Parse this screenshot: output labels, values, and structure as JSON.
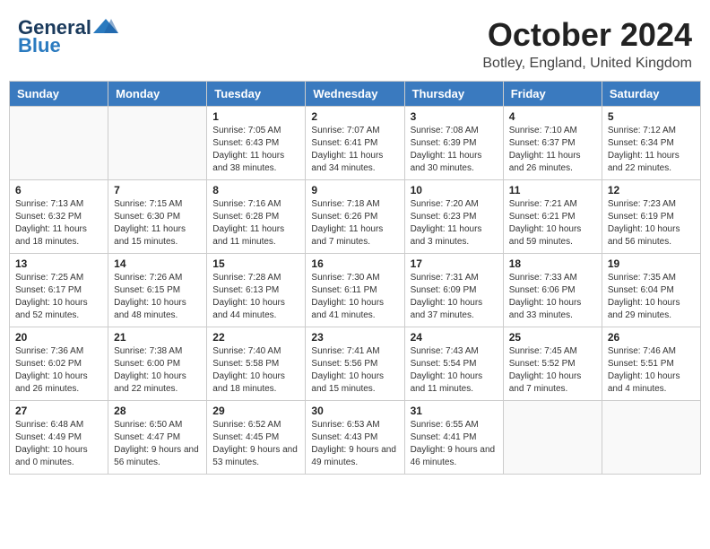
{
  "header": {
    "logo_general": "General",
    "logo_blue": "Blue",
    "month": "October 2024",
    "location": "Botley, England, United Kingdom"
  },
  "days_of_week": [
    "Sunday",
    "Monday",
    "Tuesday",
    "Wednesday",
    "Thursday",
    "Friday",
    "Saturday"
  ],
  "weeks": [
    [
      {
        "day": "",
        "detail": ""
      },
      {
        "day": "",
        "detail": ""
      },
      {
        "day": "1",
        "detail": "Sunrise: 7:05 AM\nSunset: 6:43 PM\nDaylight: 11 hours and 38 minutes."
      },
      {
        "day": "2",
        "detail": "Sunrise: 7:07 AM\nSunset: 6:41 PM\nDaylight: 11 hours and 34 minutes."
      },
      {
        "day": "3",
        "detail": "Sunrise: 7:08 AM\nSunset: 6:39 PM\nDaylight: 11 hours and 30 minutes."
      },
      {
        "day": "4",
        "detail": "Sunrise: 7:10 AM\nSunset: 6:37 PM\nDaylight: 11 hours and 26 minutes."
      },
      {
        "day": "5",
        "detail": "Sunrise: 7:12 AM\nSunset: 6:34 PM\nDaylight: 11 hours and 22 minutes."
      }
    ],
    [
      {
        "day": "6",
        "detail": "Sunrise: 7:13 AM\nSunset: 6:32 PM\nDaylight: 11 hours and 18 minutes."
      },
      {
        "day": "7",
        "detail": "Sunrise: 7:15 AM\nSunset: 6:30 PM\nDaylight: 11 hours and 15 minutes."
      },
      {
        "day": "8",
        "detail": "Sunrise: 7:16 AM\nSunset: 6:28 PM\nDaylight: 11 hours and 11 minutes."
      },
      {
        "day": "9",
        "detail": "Sunrise: 7:18 AM\nSunset: 6:26 PM\nDaylight: 11 hours and 7 minutes."
      },
      {
        "day": "10",
        "detail": "Sunrise: 7:20 AM\nSunset: 6:23 PM\nDaylight: 11 hours and 3 minutes."
      },
      {
        "day": "11",
        "detail": "Sunrise: 7:21 AM\nSunset: 6:21 PM\nDaylight: 10 hours and 59 minutes."
      },
      {
        "day": "12",
        "detail": "Sunrise: 7:23 AM\nSunset: 6:19 PM\nDaylight: 10 hours and 56 minutes."
      }
    ],
    [
      {
        "day": "13",
        "detail": "Sunrise: 7:25 AM\nSunset: 6:17 PM\nDaylight: 10 hours and 52 minutes."
      },
      {
        "day": "14",
        "detail": "Sunrise: 7:26 AM\nSunset: 6:15 PM\nDaylight: 10 hours and 48 minutes."
      },
      {
        "day": "15",
        "detail": "Sunrise: 7:28 AM\nSunset: 6:13 PM\nDaylight: 10 hours and 44 minutes."
      },
      {
        "day": "16",
        "detail": "Sunrise: 7:30 AM\nSunset: 6:11 PM\nDaylight: 10 hours and 41 minutes."
      },
      {
        "day": "17",
        "detail": "Sunrise: 7:31 AM\nSunset: 6:09 PM\nDaylight: 10 hours and 37 minutes."
      },
      {
        "day": "18",
        "detail": "Sunrise: 7:33 AM\nSunset: 6:06 PM\nDaylight: 10 hours and 33 minutes."
      },
      {
        "day": "19",
        "detail": "Sunrise: 7:35 AM\nSunset: 6:04 PM\nDaylight: 10 hours and 29 minutes."
      }
    ],
    [
      {
        "day": "20",
        "detail": "Sunrise: 7:36 AM\nSunset: 6:02 PM\nDaylight: 10 hours and 26 minutes."
      },
      {
        "day": "21",
        "detail": "Sunrise: 7:38 AM\nSunset: 6:00 PM\nDaylight: 10 hours and 22 minutes."
      },
      {
        "day": "22",
        "detail": "Sunrise: 7:40 AM\nSunset: 5:58 PM\nDaylight: 10 hours and 18 minutes."
      },
      {
        "day": "23",
        "detail": "Sunrise: 7:41 AM\nSunset: 5:56 PM\nDaylight: 10 hours and 15 minutes."
      },
      {
        "day": "24",
        "detail": "Sunrise: 7:43 AM\nSunset: 5:54 PM\nDaylight: 10 hours and 11 minutes."
      },
      {
        "day": "25",
        "detail": "Sunrise: 7:45 AM\nSunset: 5:52 PM\nDaylight: 10 hours and 7 minutes."
      },
      {
        "day": "26",
        "detail": "Sunrise: 7:46 AM\nSunset: 5:51 PM\nDaylight: 10 hours and 4 minutes."
      }
    ],
    [
      {
        "day": "27",
        "detail": "Sunrise: 6:48 AM\nSunset: 4:49 PM\nDaylight: 10 hours and 0 minutes."
      },
      {
        "day": "28",
        "detail": "Sunrise: 6:50 AM\nSunset: 4:47 PM\nDaylight: 9 hours and 56 minutes."
      },
      {
        "day": "29",
        "detail": "Sunrise: 6:52 AM\nSunset: 4:45 PM\nDaylight: 9 hours and 53 minutes."
      },
      {
        "day": "30",
        "detail": "Sunrise: 6:53 AM\nSunset: 4:43 PM\nDaylight: 9 hours and 49 minutes."
      },
      {
        "day": "31",
        "detail": "Sunrise: 6:55 AM\nSunset: 4:41 PM\nDaylight: 9 hours and 46 minutes."
      },
      {
        "day": "",
        "detail": ""
      },
      {
        "day": "",
        "detail": ""
      }
    ]
  ]
}
